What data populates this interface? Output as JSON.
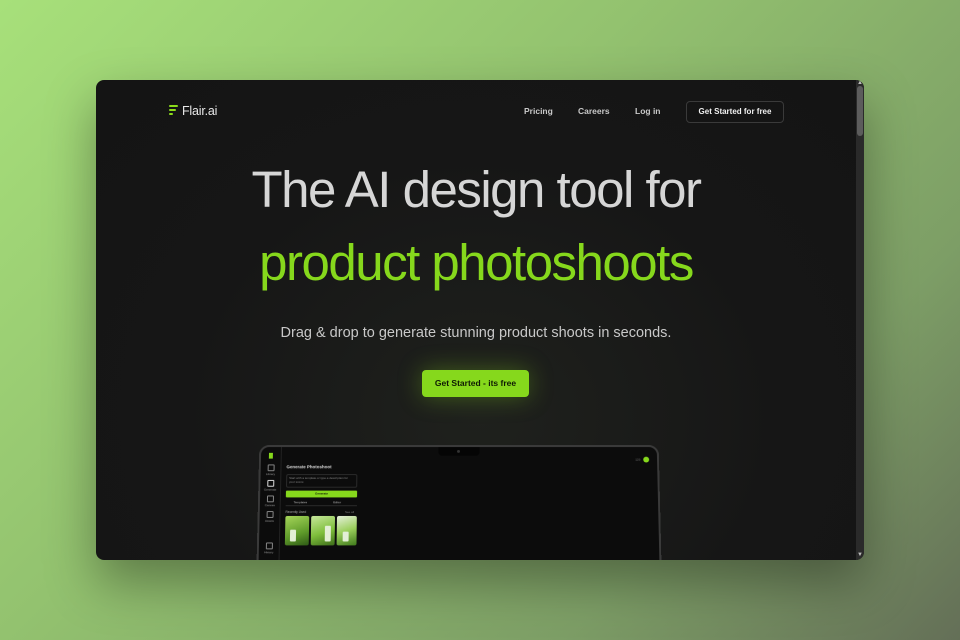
{
  "nav": {
    "logo_text": "Flair.ai",
    "links": [
      "Pricing",
      "Careers",
      "Log in"
    ],
    "cta_label": "Get Started  for free"
  },
  "hero": {
    "headline_line1": "The AI design tool for",
    "headline_line2": "product photoshoots",
    "subheadline": "Drag & drop to generate stunning product shoots in seconds.",
    "cta_label": "Get Started - its free"
  },
  "app_preview": {
    "panel_title": "Generate Photoshoot",
    "panel_hint": "Start with a template or type a description for your scene",
    "generate_label": "Generate",
    "tabs": [
      "Templates",
      "Editor"
    ],
    "recent_label": "Recently Used",
    "see_all_label": "See all",
    "sidebar_items": [
      "Library",
      "Generate",
      "Canvas",
      "Assets",
      "History"
    ],
    "credits_text": "120"
  },
  "colors": {
    "accent": "#86d81c",
    "background": "#161616",
    "headline": "#d6d6d6"
  }
}
